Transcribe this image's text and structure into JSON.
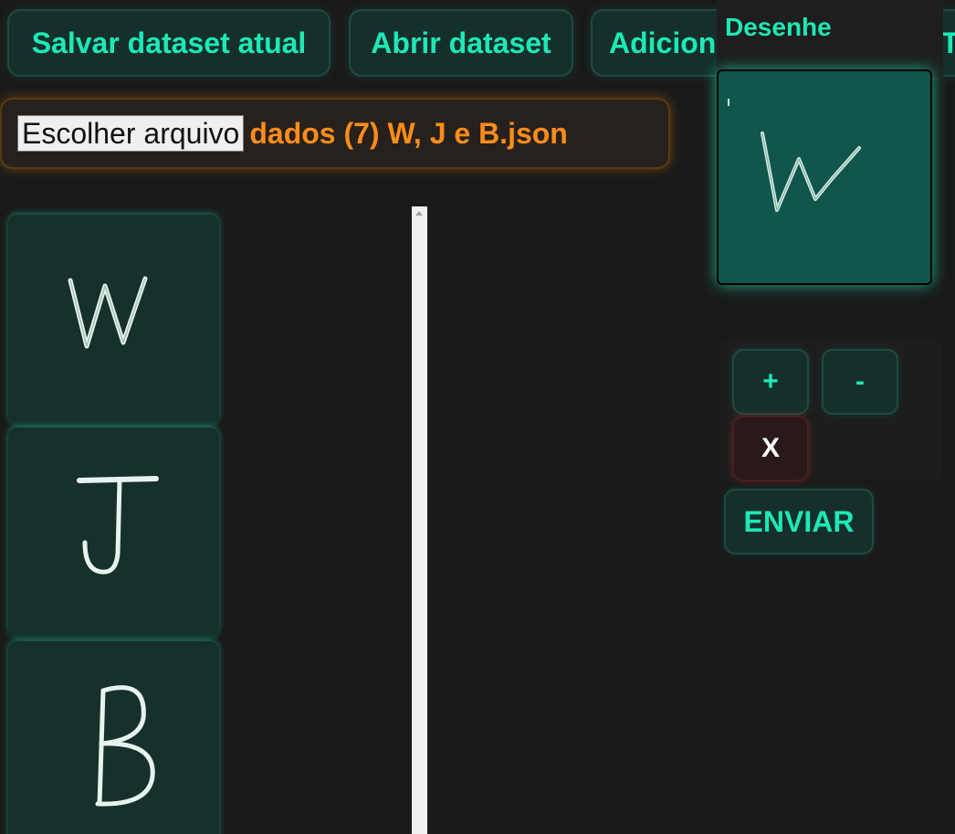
{
  "toolbar": {
    "save_label": "Salvar dataset atual",
    "open_label": "Abrir dataset",
    "add_label": "Adicionar desenho",
    "cut_label": "T"
  },
  "file_input": {
    "button_label": "Escolher arquivo",
    "file_name": "dados (7) W, J e B.json"
  },
  "dataset": {
    "items": [
      {
        "letter": "W"
      },
      {
        "letter": "J"
      },
      {
        "letter": "B"
      }
    ]
  },
  "draw_panel": {
    "title": "Desenhe",
    "current_drawing": "W"
  },
  "tools": {
    "plus_label": "+",
    "minus_label": "-",
    "clear_label": "X",
    "send_label": "ENVIAR"
  },
  "colors": {
    "accent": "#1de9b6",
    "file_name": "#ff8c1a",
    "background": "#1a1a1a",
    "card": "#16302b",
    "canvas": "#10564b"
  }
}
